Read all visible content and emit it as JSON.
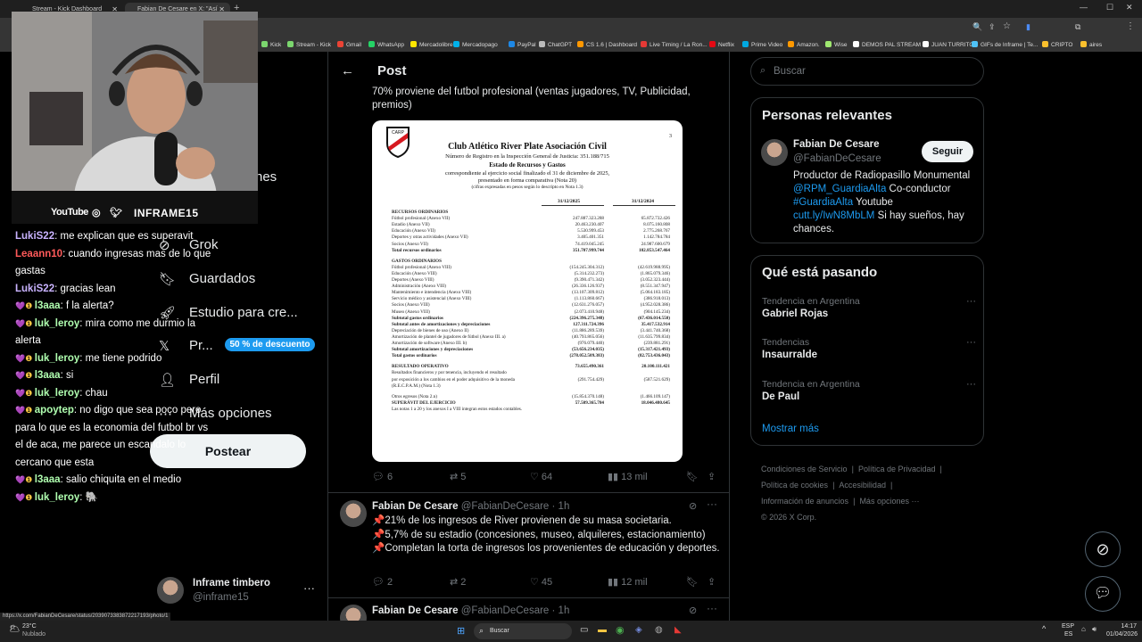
{
  "browser": {
    "tabs": [
      {
        "title": "Stream - Kick Dashboard"
      },
      {
        "title": "Fabian De Cesare en X: \"Así co..."
      }
    ],
    "bookmarks": [
      "Kick",
      "Stream - Kick",
      "Gmail",
      "WhatsApp",
      "Mercadolibre",
      "Mercadopago",
      "PayPal",
      "ChatGPT",
      "CS 1.6 | Dashboard",
      "Live Timing / La Ron...",
      "Netflix",
      "Prime Video",
      "Amazon.",
      "Wise",
      "DEMOS PAL STREAM",
      "JUAN TURRITO",
      "GIFs de Inframe | Te...",
      "CRIPTO",
      "aires"
    ],
    "status_url": "https://x.com/FabianDeCesare/status/2039073383872217193/photo/1"
  },
  "webcam": {
    "youtube": "YouTube",
    "handle": "INFRAME15"
  },
  "chat": [
    {
      "user": "LukiS22",
      "color": "#c9b3ff",
      "text": ": me explican que es superavit"
    },
    {
      "user": "Leaann10",
      "color": "#ff5a5a",
      "text": ": cuando ingresas mas de lo que gastas"
    },
    {
      "user": "LukiS22",
      "color": "#c9b3ff",
      "text": ": gracias lean"
    },
    {
      "user": "l3aaa",
      "color": "#b0ffb0",
      "text": ": f la alerta?",
      "badge": true
    },
    {
      "user": "luk_leroy",
      "color": "#b0ffb0",
      "text": ": mira como me durmio la alerta",
      "badge": true
    },
    {
      "user": "luk_leroy",
      "color": "#b0ffb0",
      "text": ": me tiene podrido",
      "badge": true
    },
    {
      "user": "l3aaa",
      "color": "#b0ffb0",
      "text": ": si",
      "badge": true
    },
    {
      "user": "luk_leroy",
      "color": "#b0ffb0",
      "text": ": chau",
      "badge": true
    },
    {
      "user": "apoytep",
      "color": "#b0ffb0",
      "text": ": no digo que sea poco pero para lo que es la economia del futbol br vs el de aca, me parece un escandalo lo cercano que esta",
      "badge": true
    },
    {
      "user": "l3aaa",
      "color": "#b0ffb0",
      "text": ": salio chiquita en el medio",
      "badge": true
    },
    {
      "user": "luk_leroy",
      "color": "#b0ffb0",
      "text": ": 🐘",
      "badge": true
    }
  ],
  "nav": {
    "items": [
      {
        "label": "nes"
      },
      {
        "label": "Grok"
      },
      {
        "label": "Guardados"
      },
      {
        "label": "Estudio para cre..."
      },
      {
        "label": "Pr..."
      },
      {
        "label": "Perfil"
      },
      {
        "label": "Más opciones"
      }
    ],
    "promo": "50 % de descuento",
    "post_button": "Postear",
    "account_name": "Inframe timbero",
    "account_handle": "@inframe15"
  },
  "main": {
    "header": "Post",
    "tweet_text_top": "70% proviene del futbol profesional (ventas jugadores, TV, Publicidad, premios)",
    "tweet1_stats": {
      "replies": "6",
      "retweets": "5",
      "likes": "64",
      "views": "13 mil"
    },
    "tweet2": {
      "name": "Fabian De Cesare",
      "handle": "@FabianDeCesare",
      "time": "· 1h",
      "lines": [
        "📌21% de los ingresos de River provienen de su masa societaria.",
        "📌5,7% de su estadio (concesiones, museo, alquileres, estacionamiento)",
        "📌Completan la torta de ingresos los provenientes de educación y deportes."
      ],
      "stats": {
        "replies": "2",
        "retweets": "2",
        "likes": "45",
        "views": "12 mil"
      }
    },
    "tweet3": {
      "name": "Fabian De Cesare",
      "handle": "@FabianDeCesare",
      "time": "· 1h"
    }
  },
  "document": {
    "page_num": "3",
    "title": "Club Atlético River Plate Asociación Civil",
    "subtitle": "Número de Registro en la Inspección General de Justicia: 351.188/715",
    "heading": "Estado de Recursos y Gastos",
    "line1": "correspondiente al ejercicio social finalizado el 31 de diciembre de 2025,",
    "line2": "presentado en forma comparativa (Nota 20)",
    "line3": "(cifras expresadas en pesos según lo descripto en Nota 1.3)",
    "col1": "31/12/2025",
    "col2": "31/12/2024",
    "rows": [
      {
        "l": "RECURSOS ORDINARIOS",
        "a": "",
        "b": "",
        "bold": true
      },
      {
        "l": "Fútbol profesional (Anexo VII)",
        "a": "247.887.323.288",
        "b": "65.872.732.426"
      },
      {
        "l": "Estadio (Anexo VII)",
        "a": "20.463.230.407",
        "b": "8.075.160.808"
      },
      {
        "l": "Educación (Anexo VII)",
        "a": "5.530.999.453",
        "b": "2.775.268.767"
      },
      {
        "l": "Deportes y otras actividades (Anexo VII)",
        "a": "3.405.401.351",
        "b": "1.142.784.784"
      },
      {
        "l": "Socios (Anexo VII)",
        "a": "74.419.045.245",
        "b": "24.987.600.679"
      },
      {
        "l": "Total recursos ordinarios",
        "a": "351.707.999.744",
        "b": "102.853.547.464",
        "bold": true
      },
      {
        "l": "",
        "a": "",
        "b": ""
      },
      {
        "l": "GASTOS ORDINARIOS",
        "a": "",
        "b": "",
        "bold": true
      },
      {
        "l": "Fútbol profesional (Anexo VIII)",
        "a": "(154.245.304.312)",
        "b": "(42.619.988.995)"
      },
      {
        "l": "Educación (Anexo VIII)",
        "a": "(5.314.232.273)",
        "b": "(1.865.079.346)"
      },
      {
        "l": "Deportes (Anexo VIII)",
        "a": "(9.390.471.342)",
        "b": "(3.052.323.444)"
      },
      {
        "l": "Administración (Anexo VIII)",
        "a": "(26.336.126.937)",
        "b": "(8.551.347.947)"
      },
      {
        "l": "Mantenimiento e intendencia (Anexo VIII)",
        "a": "(13.107.309.812)",
        "b": "(5.064.183.185)"
      },
      {
        "l": "Servicio médico y asistencial (Anexo VIII)",
        "a": "(1.113.860.667)",
        "b": "(386.918.013)"
      },
      {
        "l": "Socios (Anexo VIII)",
        "a": "(12.631.276.057)",
        "b": "(4.952.028.386)"
      },
      {
        "l": "Museo (Anexo VIII)",
        "a": "(2.073.410.948)",
        "b": "(904.145.234)"
      },
      {
        "l": "Subtotal gastos ordinarios",
        "a": "(224.396.275.348)",
        "b": "(67.436.014.550)",
        "bold": true
      },
      {
        "l": "Subtotal antes de amortizaciones y depreciaciones",
        "a": "127.311.724.396",
        "b": "35.417.532.914",
        "bold": true
      },
      {
        "l": "Depreciación de bienes de uso (Anexo II)",
        "a": "(11.886.289.539)",
        "b": "(3.441.740.368)"
      },
      {
        "l": "Amortización de plantel de jugadores de fútbol (Anexo III. a)",
        "a": "(40.793.865.056)",
        "b": "(11.635.799.834)"
      },
      {
        "l": "Amortización de software (Anexo III. b)",
        "a": "(976.079.440)",
        "b": "(239.881.291)"
      },
      {
        "l": "Subtotal amortizaciones y depreciaciones",
        "a": "(53.656.234.035)",
        "b": "(15.317.421.493)",
        "bold": true
      },
      {
        "l": "Total gastos ordinarios",
        "a": "(278.052.509.383)",
        "b": "(82.753.436.043)",
        "bold": true
      },
      {
        "l": "",
        "a": "",
        "b": ""
      },
      {
        "l": "RESULTADO OPERATIVO",
        "a": "73.655.490.361",
        "b": "20.100.111.421",
        "bold": true
      },
      {
        "l": "Resultados financieros y por tenencia, incluyendo el resultado",
        "a": "",
        "b": ""
      },
      {
        "l": "por exposición a los cambios en el poder adquisitivo de la moneda",
        "a": "(291.754.429)",
        "b": "(587.521.629)"
      },
      {
        "l": "(R.E.C.P.A.M.) (Nota 1.3)",
        "a": "",
        "b": ""
      },
      {
        "l": "",
        "a": "",
        "b": ""
      },
      {
        "l": "Otros egresos (Nota 2.n)",
        "a": "(15.854.370.148)",
        "b": "(1.466.109.147)"
      },
      {
        "l": "SUPERÁVIT DEL EJERCICIO",
        "a": "57.509.365.784",
        "b": "18.046.480.645",
        "bold": true
      },
      {
        "l": "Las notas 1 a 20 y los anexos I a VIII integran estos estados contables.",
        "a": "",
        "b": ""
      }
    ]
  },
  "right": {
    "search_placeholder": "Buscar",
    "relevant_title": "Personas relevantes",
    "person": {
      "name": "Fabian De Cesare",
      "handle": "@FabianDeCesare",
      "follow": "Seguir",
      "bio1": "Productor de Radiopasillo Monumental",
      "bio2a": "@RPM_GuardiaAlta",
      "bio2b": " Co-conductor",
      "bio3a": "#GuardiaAlta",
      "bio3b": " Youtube",
      "bio4a": "cutt.ly/IwN8MbLM",
      "bio4b": " Si hay sueños, hay chances."
    },
    "trends_title": "Qué está pasando",
    "trends": [
      {
        "cat": "Tendencia en Argentina",
        "name": "Gabriel Rojas"
      },
      {
        "cat": "Tendencias",
        "name": "Insaurralde"
      },
      {
        "cat": "Tendencia en Argentina",
        "name": "De Paul"
      }
    ],
    "show_more": "Mostrar más",
    "footer": [
      "Condiciones de Servicio",
      "|",
      "Política de Privacidad",
      "|",
      "Política de cookies",
      "|",
      "Accesibilidad",
      "|",
      "Información de anuncios",
      "|",
      "Más opciones ···",
      "© 2026 X Corp."
    ]
  },
  "taskbar": {
    "weather_temp": "23°C",
    "weather_desc": "Nublado",
    "search": "Buscar",
    "lang1": "ESP",
    "lang2": "ES",
    "time": "14:17",
    "date": "01/04/2026"
  }
}
